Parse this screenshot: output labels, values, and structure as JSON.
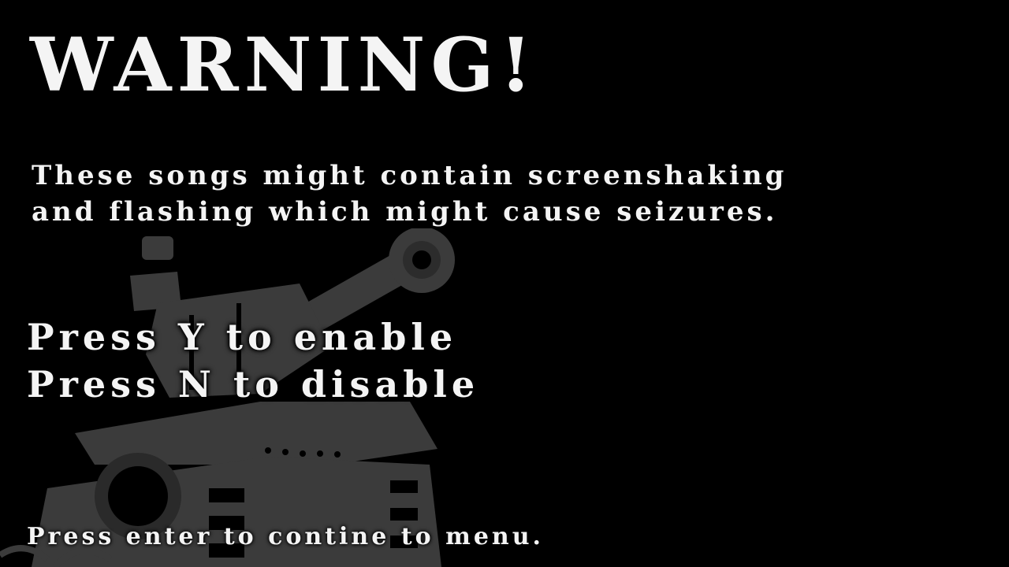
{
  "warning": {
    "title": "WARNING!",
    "line1": "These songs might contain screenshaking",
    "line2": "and flashing which might cause seizures.",
    "prompt_enable": "Press Y to enable",
    "prompt_disable": "Press N to disable",
    "footer": "Press enter to contine to menu."
  },
  "background": {
    "art": "tank-silhouette",
    "art_color": "#3a3a3a",
    "bg_color": "#000000",
    "text_color": "#f4f4f4"
  }
}
